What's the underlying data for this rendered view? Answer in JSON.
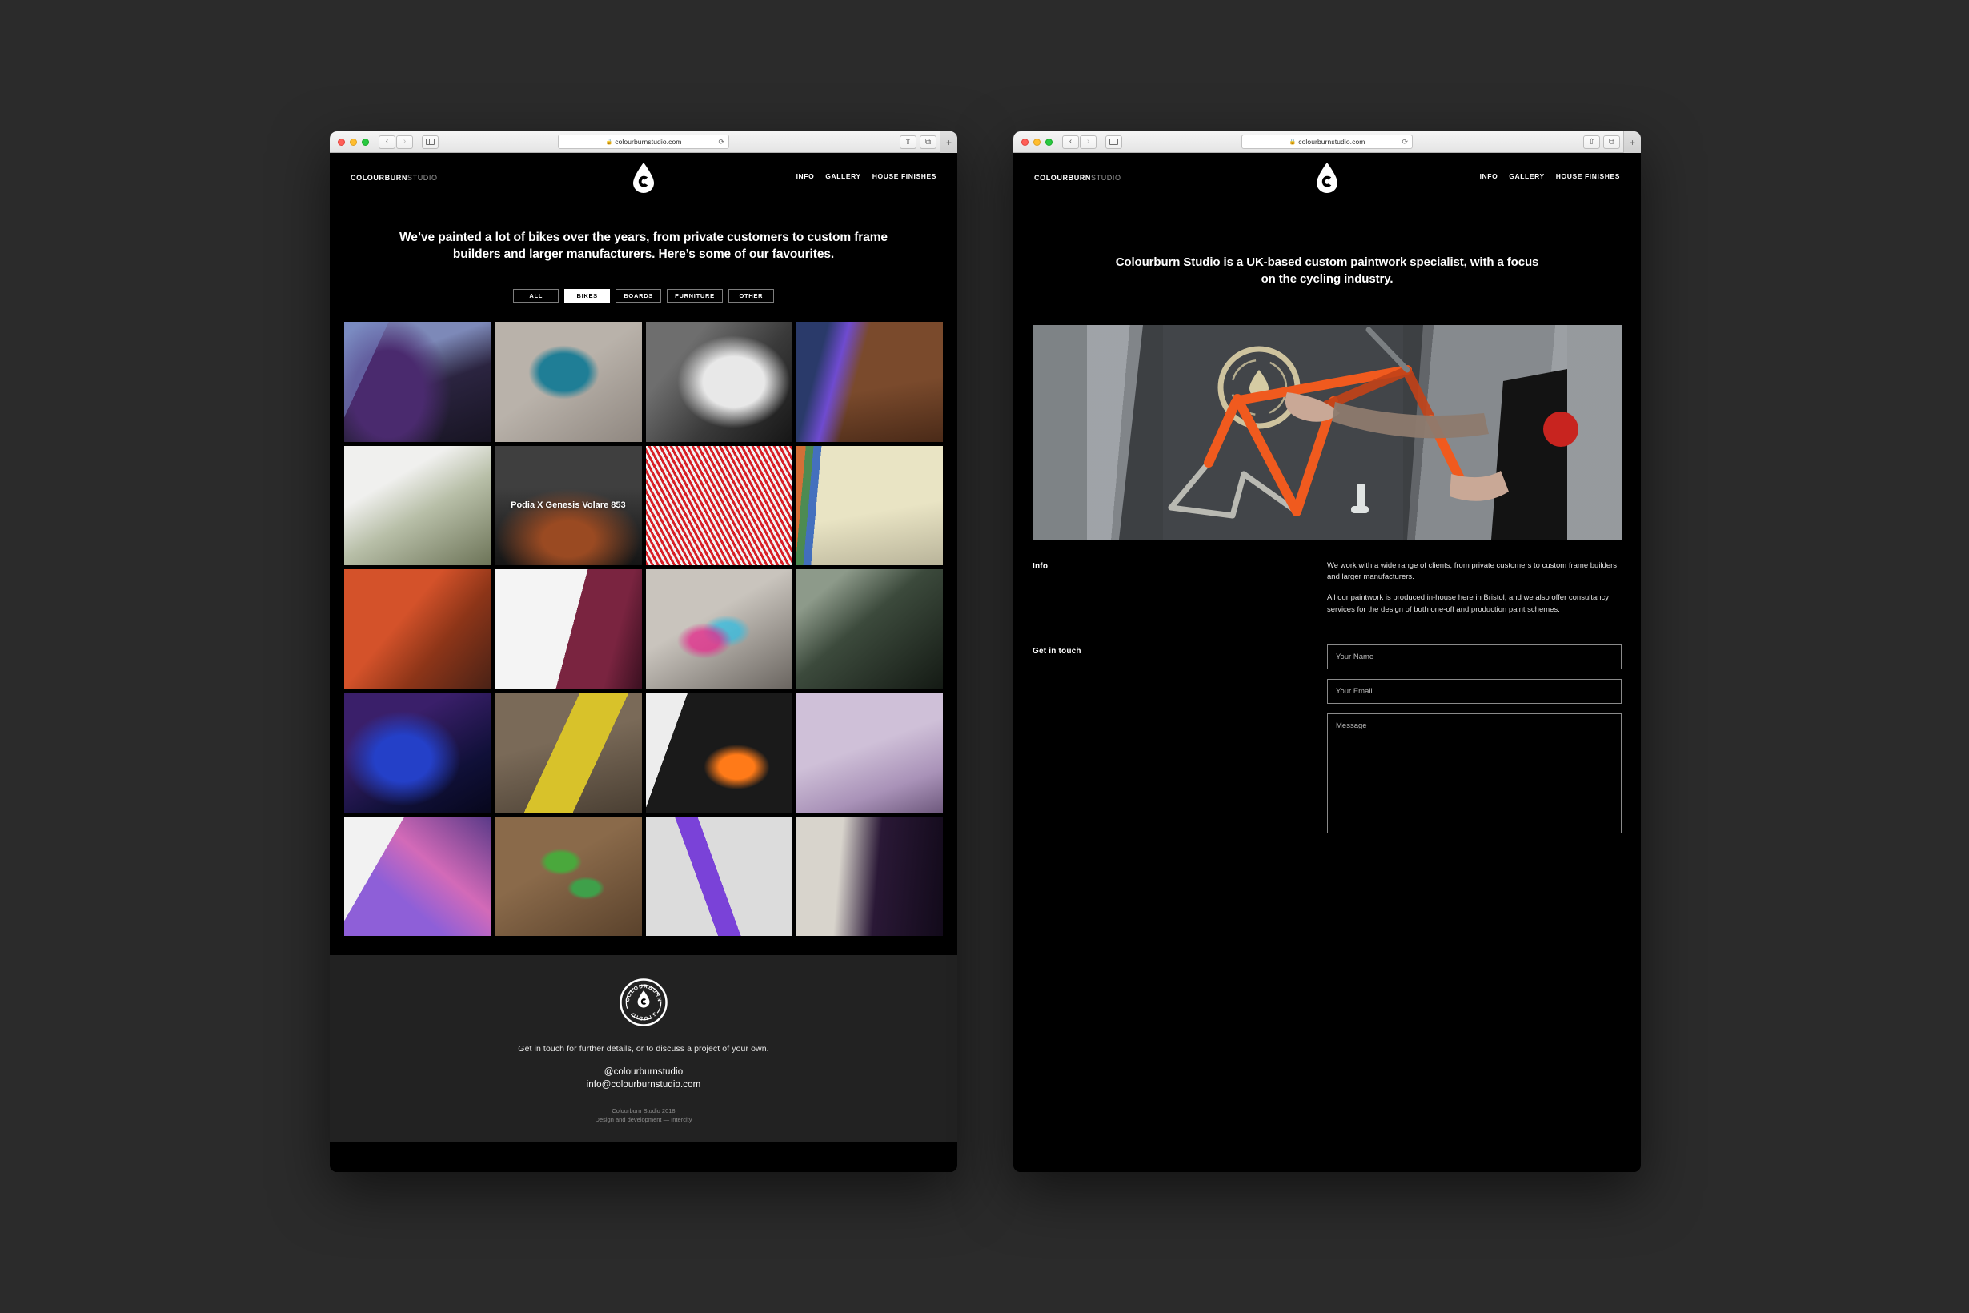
{
  "browser": {
    "url": "colourburnstudio.com",
    "lock_icon": "lock-icon",
    "reload_icon": "reload-icon",
    "back_glyph": "‹",
    "forward_glyph": "›",
    "share_glyph": "⇧",
    "tabs_glyph": "⧉",
    "plus_glyph": "+"
  },
  "brand": {
    "wordmark_bold": "COLOURBURN",
    "wordmark_light": "STUDIO",
    "seal_top": "COLOURBURN",
    "seal_bottom": "STUDIO",
    "logo_icon": "drop-c-logo-icon"
  },
  "gallery_window": {
    "nav": [
      {
        "label": "INFO",
        "active": false
      },
      {
        "label": "GALLERY",
        "active": true
      },
      {
        "label": "HOUSE FINISHES",
        "active": false
      }
    ],
    "hero": "We’ve painted a lot of bikes over the years, from private customers to custom frame builders and larger manufacturers. Here’s some of our favourites.",
    "filters": [
      {
        "label": "ALL",
        "active": false
      },
      {
        "label": "BIKES",
        "active": true
      },
      {
        "label": "BOARDS",
        "active": false
      },
      {
        "label": "FURNITURE",
        "active": false
      },
      {
        "label": "OTHER",
        "active": false
      }
    ],
    "tiles": [
      {
        "name": "argonaut-purple-road-frame",
        "caption": ""
      },
      {
        "name": "teal-spotted-stem-pink-frame",
        "caption": ""
      },
      {
        "name": "canyon-white-speckled-frame",
        "caption": ""
      },
      {
        "name": "iridescent-fork-wood-bench",
        "caption": ""
      },
      {
        "name": "olive-frame-in-workstand",
        "caption": ""
      },
      {
        "name": "podia-x-genesis",
        "caption": "Podia X Genesis Volare 853"
      },
      {
        "name": "red-white-striped-frame",
        "caption": ""
      },
      {
        "name": "cream-frame-colour-chevrons",
        "caption": ""
      },
      {
        "name": "orange-camo-frame-fence",
        "caption": ""
      },
      {
        "name": "genesis-maroon-wheel",
        "caption": ""
      },
      {
        "name": "grey-pink-splatter-frame",
        "caption": ""
      },
      {
        "name": "dark-green-works-frame",
        "caption": ""
      },
      {
        "name": "blue-sparkle-crest-frame",
        "caption": ""
      },
      {
        "name": "yellow-gravel-fork-wall",
        "caption": ""
      },
      {
        "name": "kojak-black-yellow-tt-bike",
        "caption": ""
      },
      {
        "name": "lilac-gold-decal-frame",
        "caption": ""
      },
      {
        "name": "purple-holographic-bars",
        "caption": ""
      },
      {
        "name": "green-blue-leopard-cx-frame",
        "caption": ""
      },
      {
        "name": "violet-black-track-frame",
        "caption": ""
      },
      {
        "name": "purple-black-wheel-frame",
        "caption": ""
      }
    ],
    "footer": {
      "lead": "Get in touch for further details, or to discuss a project of your own.",
      "handle": "@colourburnstudio",
      "email": "info@colourburnstudio.com",
      "copyright": "Colourburn Studio 2018",
      "credit": "Design and development — Intercity"
    }
  },
  "info_window": {
    "nav": [
      {
        "label": "INFO",
        "active": true
      },
      {
        "label": "GALLERY",
        "active": false
      },
      {
        "label": "HOUSE FINISHES",
        "active": false
      }
    ],
    "hero": "Colourburn Studio is a UK-based custom paintwork specialist, with a focus on the cycling industry.",
    "hero_photo_name": "orange-fade-titanium-frame-held-by-painter",
    "info_label": "Info",
    "info_paragraphs": [
      "We work with a wide range of clients, from private customers to custom frame builders and larger manufacturers.",
      "All our paintwork is produced in-house here in Bristol, and we also offer consultancy services for the design of both one-off and production paint schemes."
    ],
    "contact_label": "Get in touch",
    "fields": [
      {
        "name": "name-field",
        "placeholder": "Your Name",
        "value": ""
      },
      {
        "name": "email-field",
        "placeholder": "Your Email",
        "value": ""
      },
      {
        "name": "message-field",
        "placeholder": "Message",
        "value": ""
      }
    ]
  },
  "colors": {
    "page_background": "#000000",
    "desktop_background": "#2b2b2b",
    "footer_background": "#222222",
    "accent_white": "#ffffff",
    "muted_text": "#8d8d8d"
  }
}
